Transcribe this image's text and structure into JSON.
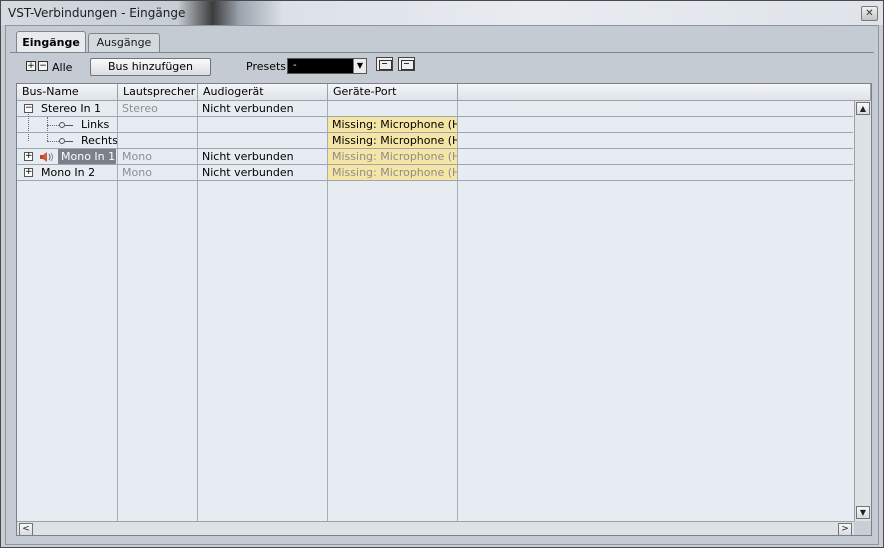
{
  "window": {
    "title": "VST-Verbindungen - Eingänge",
    "close_label": "✕"
  },
  "tabs": [
    {
      "label": "Eingänge",
      "active": true
    },
    {
      "label": "Ausgänge",
      "active": false
    }
  ],
  "toolbar": {
    "expand_all_symbol": "+",
    "collapse_all_symbol": "−",
    "all_label": "Alle",
    "add_bus_label": "Bus hinzufügen",
    "presets_label": "Presets",
    "presets_value": "-"
  },
  "columns": [
    "Bus-Name",
    "Lautsprecher",
    "Audiogerät",
    "Geräte-Port"
  ],
  "rows": [
    {
      "name": "Stereo In 1",
      "speaker": "Stereo",
      "device": "Nicht verbunden",
      "port": "",
      "expander": "−",
      "level": 0
    },
    {
      "name": "Links",
      "speaker": "",
      "device": "",
      "port": "Missing: Microphone (Hi",
      "level": 1
    },
    {
      "name": "Rechts",
      "speaker": "",
      "device": "",
      "port": "Missing: Microphone (Hi",
      "level": 1
    },
    {
      "name": "Mono In 1",
      "speaker": "Mono",
      "device": "Nicht verbunden",
      "port": "Missing: Microphone (Hi",
      "expander": "+",
      "level": 0,
      "selected": true
    },
    {
      "name": "Mono In 2",
      "speaker": "Mono",
      "device": "Nicht verbunden",
      "port": "Missing: Microphone (Hi",
      "expander": "+",
      "level": 0
    }
  ],
  "scroll": {
    "up": "▲",
    "down": "▼",
    "left": "<",
    "right": ">"
  },
  "colors": {
    "missing_bg": "#f6e6a6",
    "selection_bg": "#7b8189",
    "grid_bg": "#e6ecf2"
  }
}
